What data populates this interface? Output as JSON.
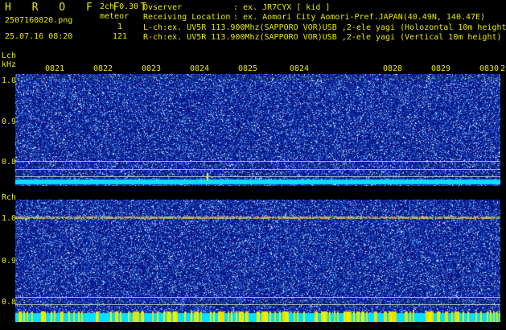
{
  "header": {
    "title": "H R O F F T",
    "filename": "2507160820.png",
    "datetime": "25.07.16 08:20",
    "channel_info": "2ch 0.30",
    "meteor_label": "meteor",
    "lch_count": "1",
    "rch_count": "121",
    "observer_label": "Ovserver",
    "observer_value": ": ex. JR7CYX [ kid ]",
    "location_label": "Receiving Location",
    "location_value": ": ex. Aomori City Aomori-Pref.JAPAN(40.49N, 140.47E)",
    "lch_desc": "L-ch:ex. UV5R 113.900Mhz(SAPPORO VOR)USB ,2-ele yagi (Holozontal 10m height)",
    "rch_desc": "R-ch:ex. UV5R 113.900Mhz(SAPPORO VOR)USB ,2-ele yagi (Vertical 10m height)"
  },
  "lch": {
    "label": "Lch",
    "unit": "kHz",
    "yticks": [
      "1.0",
      "0.9",
      "0.8"
    ]
  },
  "rch": {
    "label": "Rch",
    "yticks": [
      "1.0",
      "0.9",
      "0.8"
    ]
  },
  "time_labels": [
    "0821",
    "0822",
    "0823",
    "0824",
    "0825",
    "0824",
    "0828",
    "0829",
    "0830",
    "2"
  ],
  "colors": {
    "background": "#000000",
    "text": "#e8e800",
    "noise_dark": "#0a1a8c",
    "noise_mid": "#2a6ad8",
    "noise_bright": "#9ad0ff",
    "baseline_cyan": "#00e0ff",
    "carrier": "#ff3030"
  }
}
